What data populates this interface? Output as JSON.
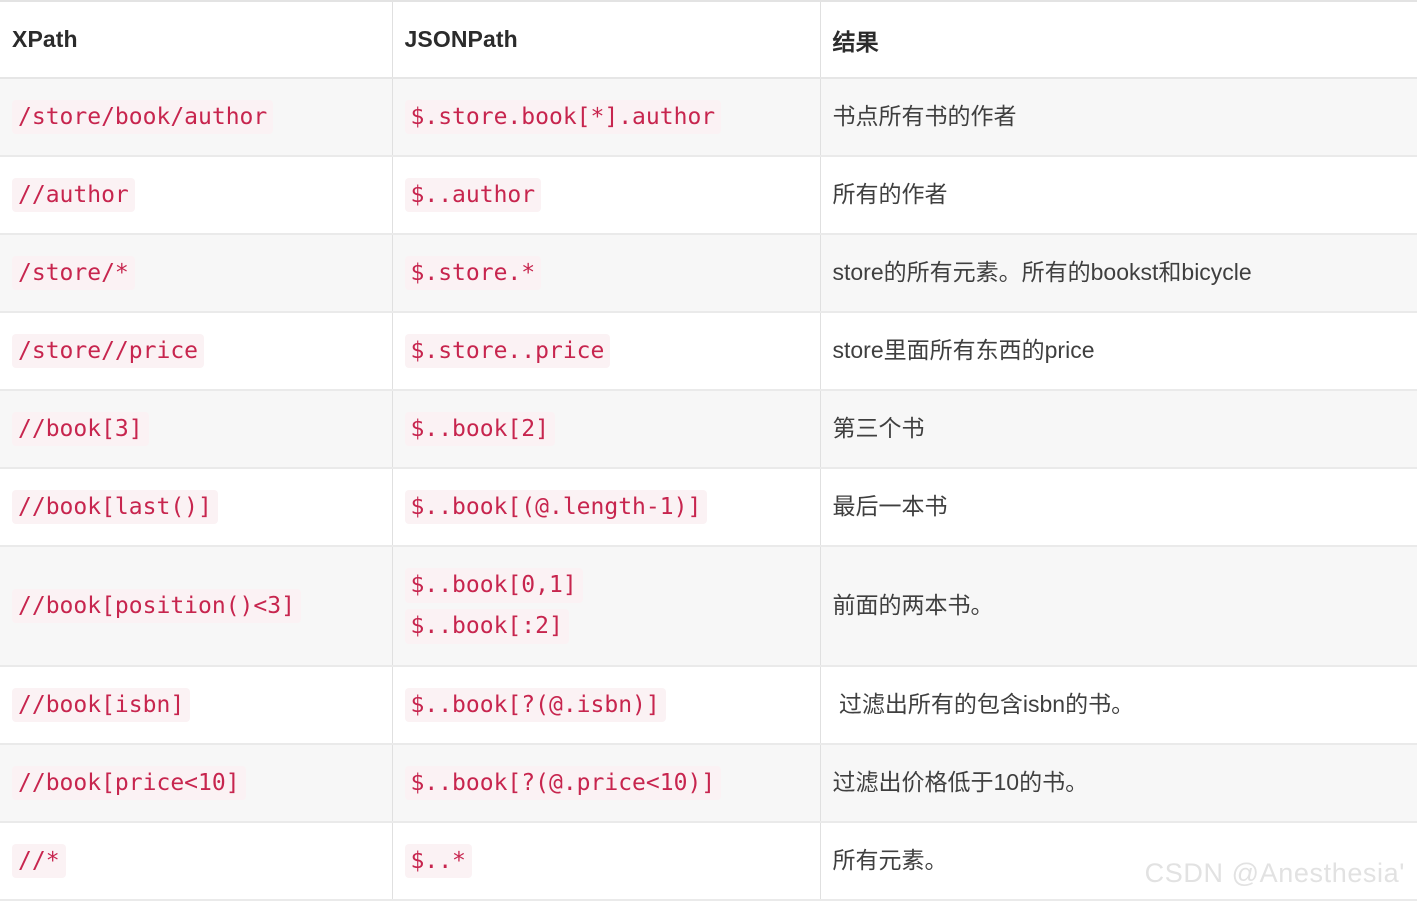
{
  "table": {
    "headers": [
      "XPath",
      "JSONPath",
      "结果"
    ],
    "rows": [
      {
        "xpath": "/store/book/author",
        "jsonpath": [
          "$.store.book[*].author"
        ],
        "result": "书点所有书的作者"
      },
      {
        "xpath": "//author",
        "jsonpath": [
          "$..author"
        ],
        "result": "所有的作者"
      },
      {
        "xpath": "/store/*",
        "jsonpath": [
          "$.store.*"
        ],
        "result": "store的所有元素。所有的bookst和bicycle"
      },
      {
        "xpath": "/store//price",
        "jsonpath": [
          "$.store..price"
        ],
        "result": "store里面所有东西的price"
      },
      {
        "xpath": "//book[3]",
        "jsonpath": [
          "$..book[2]"
        ],
        "result": "第三个书"
      },
      {
        "xpath": "//book[last()]",
        "jsonpath": [
          "$..book[(@.length-1)]"
        ],
        "result": "最后一本书"
      },
      {
        "xpath": "//book[position()<3]",
        "jsonpath": [
          "$..book[0,1]",
          "$..book[:2]"
        ],
        "result": "前面的两本书。"
      },
      {
        "xpath": "//book[isbn]",
        "jsonpath": [
          "$..book[?(@.isbn)]"
        ],
        "result": " 过滤出所有的包含isbn的书。"
      },
      {
        "xpath": "//book[price<10]",
        "jsonpath": [
          "$..book[?(@.price<10)]"
        ],
        "result": "过滤出价格低于10的书。"
      },
      {
        "xpath": "//*",
        "jsonpath": [
          "$..*"
        ],
        "result": "所有元素。"
      }
    ]
  },
  "watermark": {
    "text": "CSDN @Anesthesia'"
  },
  "colors": {
    "code_text": "#c7254e",
    "code_bg": "#fbf2f4",
    "header_text": "#2b2b2b",
    "result_text": "#3f3f3f",
    "row_alt_bg": "#f7f7f7",
    "row_bg": "#ffffff",
    "border": "#e0e0e0",
    "watermark": "#e2e2e2"
  }
}
